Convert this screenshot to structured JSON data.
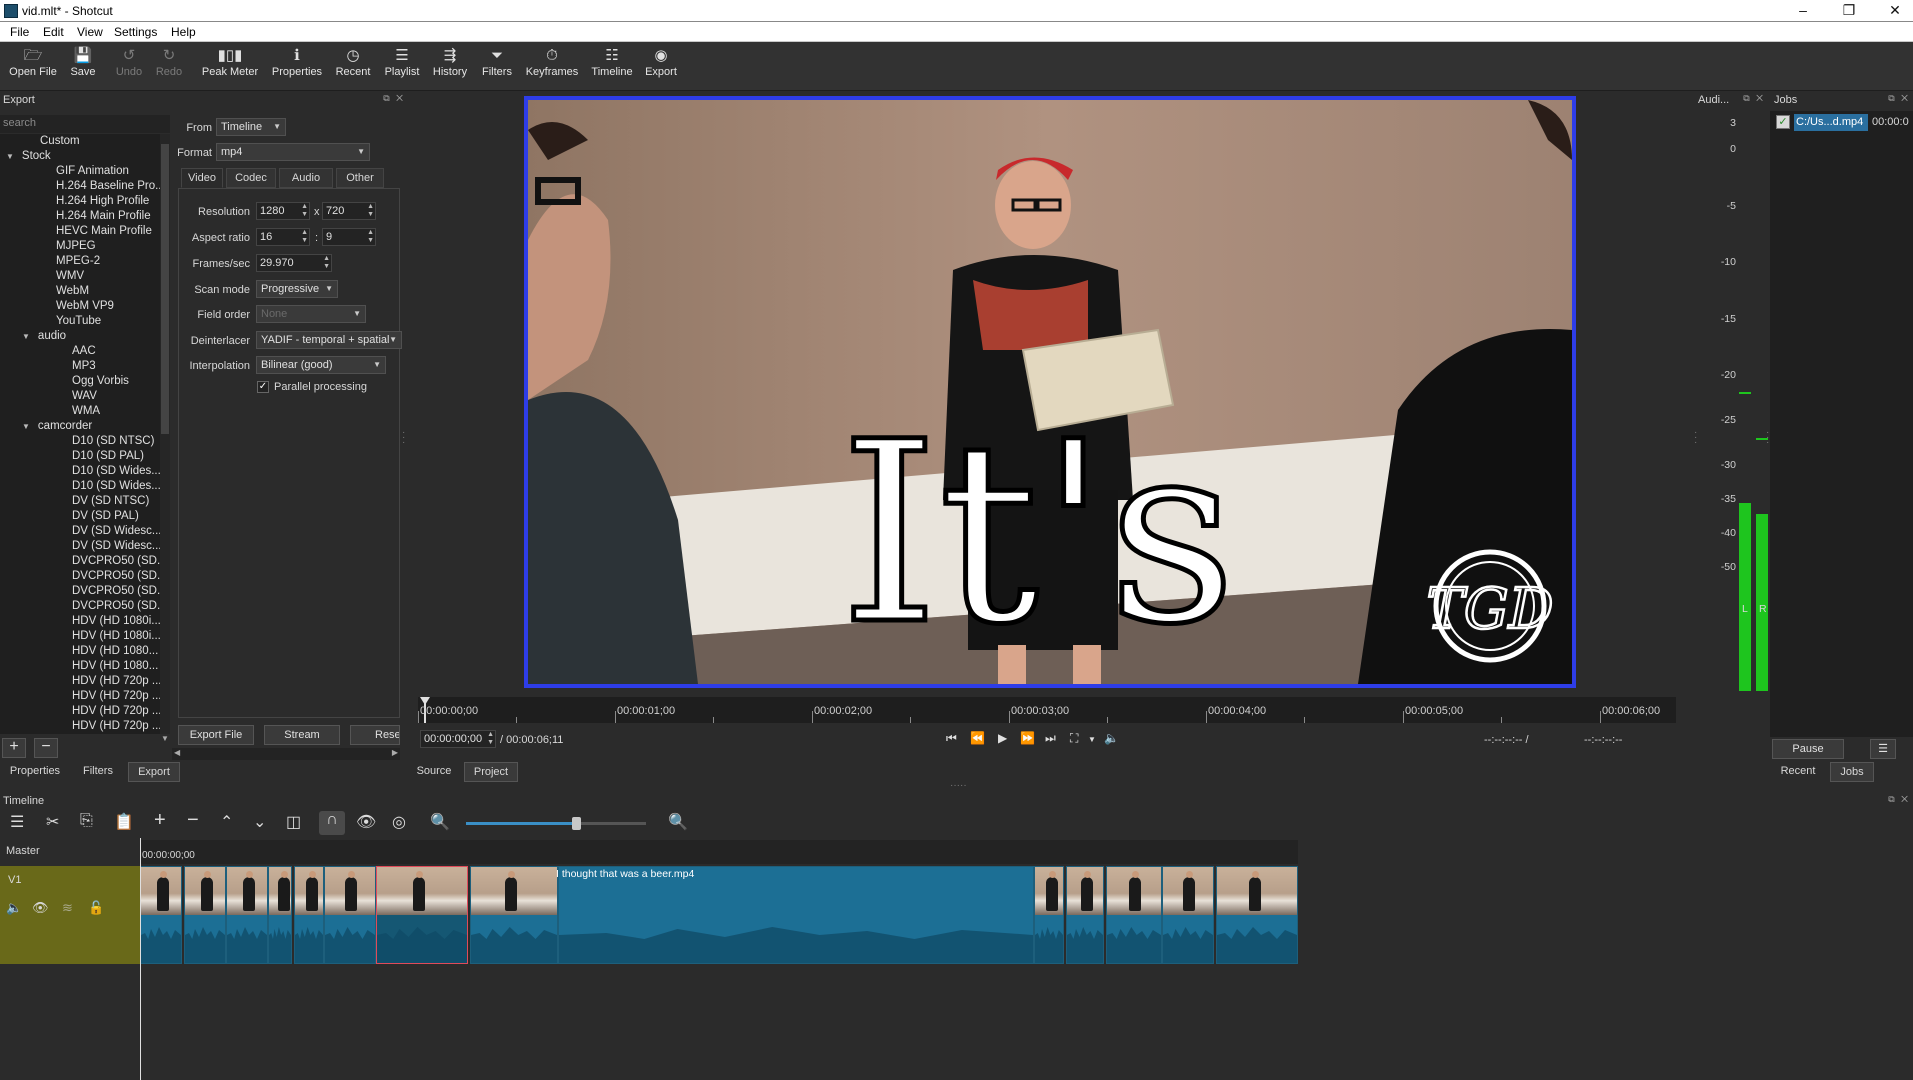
{
  "window": {
    "title": "vid.mlt* - Shotcut",
    "controls": [
      "minimize-icon",
      "restore-icon",
      "close-icon"
    ]
  },
  "menu": [
    "File",
    "Edit",
    "View",
    "Settings",
    "Help"
  ],
  "toolbar": [
    {
      "label": "Open File",
      "icon": "open-file-icon",
      "enabled": true
    },
    {
      "label": "Save",
      "icon": "save-icon",
      "enabled": true
    },
    {
      "label": "Undo",
      "icon": "undo-icon",
      "enabled": false
    },
    {
      "label": "Redo",
      "icon": "redo-icon",
      "enabled": false
    },
    {
      "label": "Peak Meter",
      "icon": "peak-meter-icon",
      "enabled": true
    },
    {
      "label": "Properties",
      "icon": "properties-icon",
      "enabled": true
    },
    {
      "label": "Recent",
      "icon": "recent-icon",
      "enabled": true
    },
    {
      "label": "Playlist",
      "icon": "playlist-icon",
      "enabled": true
    },
    {
      "label": "History",
      "icon": "history-icon",
      "enabled": true
    },
    {
      "label": "Filters",
      "icon": "filters-icon",
      "enabled": true
    },
    {
      "label": "Keyframes",
      "icon": "keyframes-icon",
      "enabled": true
    },
    {
      "label": "Timeline",
      "icon": "timeline-icon",
      "enabled": true
    },
    {
      "label": "Export",
      "icon": "export-icon",
      "enabled": true
    }
  ],
  "export_panel": {
    "title": "Export",
    "search_placeholder": "search",
    "tree": [
      {
        "label": "Custom",
        "depth": 1
      },
      {
        "label": "Stock",
        "depth": 0,
        "expanded": true
      },
      {
        "label": "GIF Animation",
        "depth": 2
      },
      {
        "label": "H.264 Baseline Pro...",
        "depth": 2
      },
      {
        "label": "H.264 High Profile",
        "depth": 2
      },
      {
        "label": "H.264 Main Profile",
        "depth": 2
      },
      {
        "label": "HEVC Main Profile",
        "depth": 2
      },
      {
        "label": "MJPEG",
        "depth": 2
      },
      {
        "label": "MPEG-2",
        "depth": 2
      },
      {
        "label": "WMV",
        "depth": 2
      },
      {
        "label": "WebM",
        "depth": 2
      },
      {
        "label": "WebM VP9",
        "depth": 2
      },
      {
        "label": "YouTube",
        "depth": 2
      },
      {
        "label": "audio",
        "depth": 1,
        "expanded": true
      },
      {
        "label": "AAC",
        "depth": 3
      },
      {
        "label": "MP3",
        "depth": 3
      },
      {
        "label": "Ogg Vorbis",
        "depth": 3
      },
      {
        "label": "WAV",
        "depth": 3
      },
      {
        "label": "WMA",
        "depth": 3
      },
      {
        "label": "camcorder",
        "depth": 1,
        "expanded": true
      },
      {
        "label": "D10 (SD NTSC)",
        "depth": 3
      },
      {
        "label": "D10 (SD PAL)",
        "depth": 3
      },
      {
        "label": "D10 (SD Wides...",
        "depth": 3
      },
      {
        "label": "D10 (SD Wides...",
        "depth": 3
      },
      {
        "label": "DV (SD NTSC)",
        "depth": 3
      },
      {
        "label": "DV (SD PAL)",
        "depth": 3
      },
      {
        "label": "DV (SD Widesc...",
        "depth": 3
      },
      {
        "label": "DV (SD Widesc...",
        "depth": 3
      },
      {
        "label": "DVCPRO50 (SD...",
        "depth": 3
      },
      {
        "label": "DVCPRO50 (SD...",
        "depth": 3
      },
      {
        "label": "DVCPRO50 (SD...",
        "depth": 3
      },
      {
        "label": "DVCPRO50 (SD...",
        "depth": 3
      },
      {
        "label": "HDV (HD 1080i...",
        "depth": 3
      },
      {
        "label": "HDV (HD 1080i...",
        "depth": 3
      },
      {
        "label": "HDV (HD 1080...",
        "depth": 3
      },
      {
        "label": "HDV (HD 1080...",
        "depth": 3
      },
      {
        "label": "HDV (HD 720p ...",
        "depth": 3
      },
      {
        "label": "HDV (HD 720p ...",
        "depth": 3
      },
      {
        "label": "HDV (HD 720p ...",
        "depth": 3
      },
      {
        "label": "HDV (HD 720p ...",
        "depth": 3
      }
    ],
    "from_label": "From",
    "from_value": "Timeline",
    "format_label": "Format",
    "format_value": "mp4",
    "tabs": [
      "Video",
      "Codec",
      "Audio",
      "Other"
    ],
    "active_tab": "Video",
    "resolution_label": "Resolution",
    "resolution_w": "1280",
    "resolution_x": "x",
    "resolution_h": "720",
    "aspect_label": "Aspect ratio",
    "aspect_w": "16",
    "aspect_colon": ":",
    "aspect_h": "9",
    "fps_label": "Frames/sec",
    "fps_value": "29.970",
    "scan_label": "Scan mode",
    "scan_value": "Progressive",
    "field_label": "Field order",
    "field_value": "None",
    "deint_label": "Deinterlacer",
    "deint_value": "YADIF - temporal + spatial",
    "interp_label": "Interpolation",
    "interp_value": "Bilinear (good)",
    "parallel_label": "Parallel processing",
    "parallel_checked": true,
    "export_file_btn": "Export File",
    "stream_btn": "Stream",
    "reset_btn": "Rese"
  },
  "left_bottom_tabs": [
    "Properties",
    "Filters",
    "Export"
  ],
  "left_bottom_active": "Export",
  "preview": {
    "overlay_text": "It's",
    "logo_text": "TGD",
    "border_color": "#2e3de8"
  },
  "ruler_labels": [
    "00:00:00;00",
    "00:00:01;00",
    "00:00:02;00",
    "00:00:03;00",
    "00:00:04;00",
    "00:00:05;00",
    "00:00:06;00"
  ],
  "transport": {
    "position": "00:00:00;00",
    "duration": "/ 00:00:06;11",
    "in_point": "--:--:--:-- /",
    "out_point": "--:--:--:--"
  },
  "player_tabs": [
    "Source",
    "Project"
  ],
  "player_active_tab": "Project",
  "audio_meter": {
    "title": "Audi...",
    "scale": [
      "3",
      "0",
      "-5",
      "-10",
      "-15",
      "-20",
      "-25",
      "-30",
      "-35",
      "-40",
      "-50"
    ],
    "channels": [
      "L",
      "R"
    ],
    "level_left": 0.33,
    "level_right": 0.31,
    "color": "#1ec51e"
  },
  "jobs": {
    "title": "Jobs",
    "items": [
      {
        "name": "C:/Us...d.mp4",
        "time": "00:00:0"
      }
    ],
    "pause_btn": "Pause",
    "tabs": [
      "Recent",
      "Jobs"
    ],
    "active_tab": "Jobs"
  },
  "timeline": {
    "title": "Timeline",
    "master_label": "Master",
    "track_label": "V1",
    "timecode": "00:00:00;00",
    "clip_caption": "I thought that was a beer.mp4",
    "track_color": "#696919",
    "clip_color": "#1c6f95"
  }
}
